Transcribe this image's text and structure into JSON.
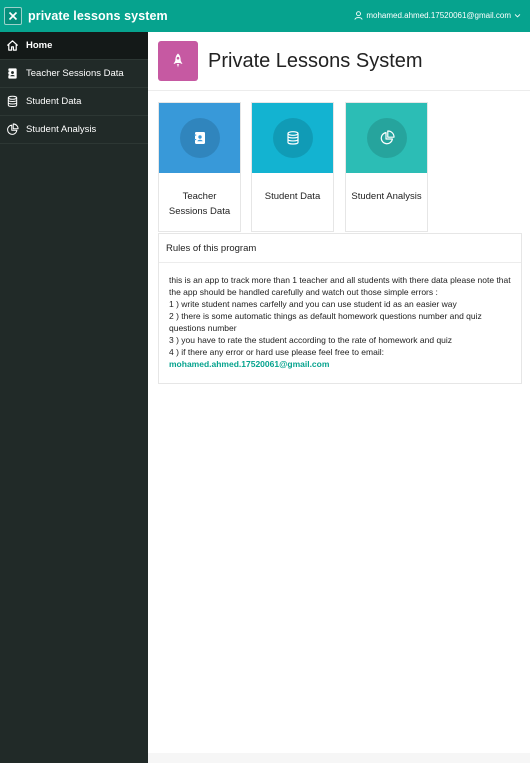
{
  "topbar": {
    "app_title": "private lessons system",
    "user_email": "mohamed.ahmed.17520061@gmail.com"
  },
  "sidebar": {
    "items": [
      {
        "label": "Home",
        "icon": "home-icon",
        "active": true
      },
      {
        "label": "Teacher Sessions Data",
        "icon": "contact-book-icon",
        "active": false
      },
      {
        "label": "Student Data",
        "icon": "database-icon",
        "active": false
      },
      {
        "label": "Student Analysis",
        "icon": "pie-chart-icon",
        "active": false
      }
    ]
  },
  "header": {
    "title": "Private Lessons System",
    "logo_icon": "rocket-icon"
  },
  "cards": [
    {
      "label": "Teacher Sessions Data",
      "icon": "contact-book-icon",
      "color": "#3899d9"
    },
    {
      "label": "Student Data",
      "icon": "database-icon",
      "color": "#13b3d1"
    },
    {
      "label": "Student Analysis",
      "icon": "pie-chart-icon",
      "color": "#2cbdb5"
    }
  ],
  "rules": {
    "title": "Rules of this program",
    "lines": [
      "this is an app to track more than 1 teacher and all students with there data please note that the app should be handled carefully and watch out those simple errors :",
      "1 ) write student names carfelly and you can use student id as an easier way",
      "2 ) there is some automatic things as default homework questions number and quiz questions number",
      "3 ) you have to rate the student according to the rate of homework and quiz",
      "4 ) if there any error or hard use please feel free to email:"
    ],
    "email": "mohamed.ahmed.17520061@gmail.com"
  },
  "colors": {
    "topbar": "#06a38e",
    "sidebar": "#212a28",
    "logo": "#c659a2"
  }
}
